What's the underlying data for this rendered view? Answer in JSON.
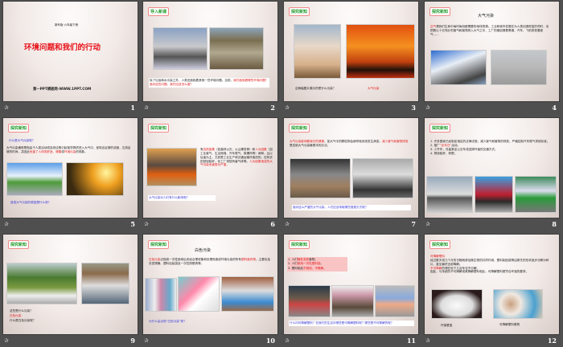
{
  "slides": [
    {
      "number": "1",
      "subtitle": "新科版  六年级下册",
      "title": "环境问题和我们的行动",
      "footer": "第一PPT模板网-WWW.1PPT.COM"
    },
    {
      "number": "2",
      "tag": "导入新课",
      "text_black": "除了垃圾和水污染之外，人类还面临着其他一些环境问题。目前，",
      "text_red": "我们面临着哪些环境问题？面对这些问题，我们应该怎么做？"
    },
    {
      "number": "3",
      "tag": "探究新知",
      "question": "这两幅图片展示的是什么污染？",
      "answer": "大气污染"
    },
    {
      "number": "4",
      "tag": "探究新知",
      "title": "大气污染",
      "red": "空气",
      "text": "是我们生命中每时每刻都需要的地球资源。工业和城市发展在为人类创造财富的同时，也把数以十亿吨计的废气和废物排入大气之中，工厂的烟囱冒着黑烟，汽车、飞机排放着废气……"
    },
    {
      "number": "5",
      "tag": "探究新知",
      "question": "什么是大气污染呢？",
      "text1": "大气污染通常是指由于人类活动或自然过程引起某些物质进入大气中，呈现出足够的浓度，达到足够的时间，并因此",
      "red1": "危害了人体的舒适、健康",
      "text2": "或",
      "red2": "环境污染",
      "text3": "的现象。",
      "bottom": "造成大气污染的原因是什么呢？"
    },
    {
      "number": "6",
      "tag": "探究新知",
      "t1": "有",
      "r1": "自然因素",
      "t2": "（如森林火灾、火山爆发等）和",
      "r2": "人为因素",
      "t3": "（如工业废气、生活燃煤、汽车尾气、核爆炸等）两种，且以后者为主，尤其是工业生产和交通运输所造成的。还有农田焚烧秸秆，化工厂排放有害气体等。",
      "r3": "人为因素造成的大气污染危害更为严重。",
      "box": "大气污染对人们有什么影响呢？"
    },
    {
      "number": "7",
      "tag": "探究新知",
      "r1": "大气污染影响着我们的健康",
      "t1": "，如大气中的颗粒物会使呼吸系统发生病变。",
      "r2": "减少废气和废物排放",
      "t2": "是控制大气污染最根本的办法。",
      "box": "面对这么严重的大气污染，人们应该采取哪些措施方式呢？"
    },
    {
      "number": "8",
      "tag": "探究新知",
      "item1": "1. 许多国家已经制定相应的法律法规，减少废气和废物的排放，严格控制汽车尾气排放标准。",
      "item2_a": "2. 推广",
      "item2_red": "“无车日”",
      "item2_b": "活动。",
      "item3": "3. 少开车，尽量乘坐公交车或选择环保的交通方式。",
      "item4": "4. 禁烧秸秆、积肥。"
    },
    {
      "number": "9",
      "tag": "探究新知",
      "question": "这些是什么污染？",
      "answer": "白色污染",
      "question2": "什么是白色污染呢？"
    },
    {
      "number": "10",
      "tag": "探究新知",
      "title": "白色污染",
      "r1": "白色污染",
      "t1": "泛指将一次性使用后未经合理收集和处理而造成环境污染的所有",
      "r2": "塑料废弃物",
      "t2": "。主要包括农田薄膜、塑料包装袋及一次性快餐具等。",
      "question": "为什么会出现“白色污染”呢？"
    },
    {
      "number": "11",
      "tag": "探究新知",
      "l1a": "1. 人们",
      "l1r": "随处丢弃",
      "l1b": "废物。",
      "l2a": "2. 人们",
      "l2r": "使用一次性塑料袋",
      "l2b": "。",
      "l3a": "3. 塑料制品",
      "l3r": "不燃烧、不降解",
      "l3b": "。",
      "box": "什么叫可降解塑料？在我们的生活中哪些是可降解塑料呢？哪些是不可降解的呢？"
    },
    {
      "number": "12",
      "tag": "探究新知",
      "r1": "可降解塑料",
      "t1": "经过数天或几个月的日晒雨淋及微生物的共同作用，塑料制品能等由原先的形状逐步分解为碎片，直至最终全部降解。",
      "r2": "不可降解",
      "t2": "的埋在地下几百年也不分解。",
      "t3": "因此，与传统的不可降解或难降解塑料相比，可降解塑料更符合环保的要求。",
      "cap1": "环保餐盒",
      "cap2": "可降解塑料餐具"
    }
  ],
  "slide_icon": "transition-star-icon"
}
